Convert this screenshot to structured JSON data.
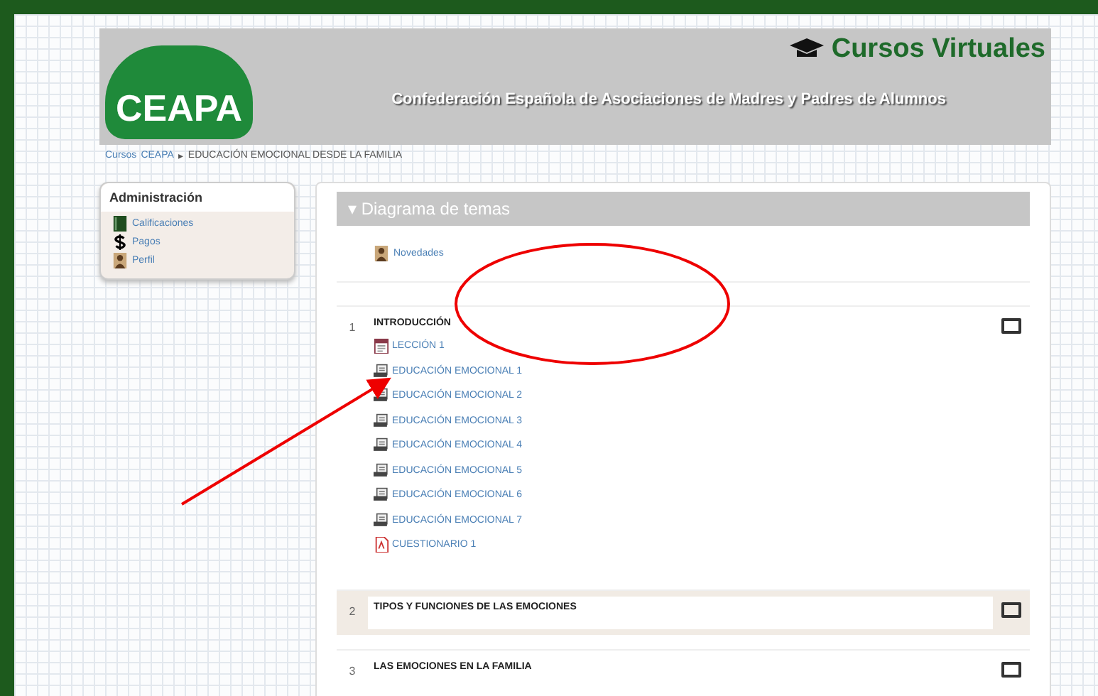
{
  "header": {
    "logo": "CEAPA",
    "brand": "Cursos Virtuales",
    "subtitle": "Confederación Española de Asociaciones de Madres y Padres de Alumnos"
  },
  "breadcrumb": [
    {
      "label": "Cursos",
      "kind": "link"
    },
    {
      "label": "CEAPA",
      "kind": "link"
    },
    {
      "label": "▸",
      "kind": "separator"
    },
    {
      "label": "EDUCACIÓN EMOCIONAL DESDE LA FAMILIA",
      "kind": "current"
    }
  ],
  "admin_block": {
    "title": "Administración",
    "items": [
      {
        "label": "Calificaciones",
        "kind": "grades"
      },
      {
        "label": "Pagos",
        "kind": "payments"
      },
      {
        "label": "Perfil",
        "kind": "profile"
      }
    ]
  },
  "course": {
    "toggle": "▾",
    "title": "Diagrama de temas",
    "news": "Novedades",
    "sections": [
      {
        "number": "1",
        "title": "INTRODUCCIÓN",
        "current": false,
        "activities": [
          {
            "label": "LECCIÓN 1",
            "kind": "lesson"
          },
          {
            "label": "EDUCACIÓN EMOCIONAL 1",
            "kind": "resource"
          },
          {
            "label": "EDUCACIÓN EMOCIONAL 2",
            "kind": "resource"
          },
          {
            "label": "EDUCACIÓN EMOCIONAL 3",
            "kind": "resource"
          },
          {
            "label": "EDUCACIÓN EMOCIONAL 4",
            "kind": "resource"
          },
          {
            "label": "EDUCACIÓN EMOCIONAL 5",
            "kind": "resource"
          },
          {
            "label": "EDUCACIÓN EMOCIONAL 6",
            "kind": "resource"
          },
          {
            "label": "EDUCACIÓN EMOCIONAL 7",
            "kind": "resource"
          },
          {
            "label": "CUESTIONARIO 1",
            "kind": "quiz"
          }
        ]
      },
      {
        "number": "2",
        "title": "TIPOS Y FUNCIONES DE LAS EMOCIONES",
        "current": true
      },
      {
        "number": "3",
        "title": "LAS EMOCIONES EN LA FAMILIA",
        "current": false
      }
    ]
  }
}
